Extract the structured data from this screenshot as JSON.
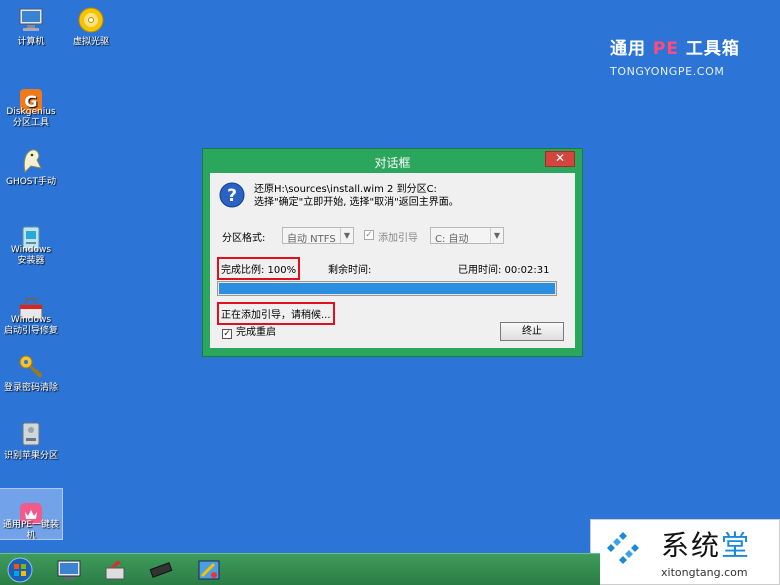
{
  "desktop": {
    "icons": [
      {
        "label": "计算机"
      },
      {
        "label": "虚拟光驱"
      },
      {
        "label": "Diskgenius\n分区工具"
      },
      {
        "label": "GHOST手动"
      },
      {
        "label": "Windows\n安装器"
      },
      {
        "label": "Windows\n启动引导修复"
      },
      {
        "label": "登录密码清除"
      },
      {
        "label": "识别苹果分区"
      },
      {
        "label": "通用PE一键装\n机"
      }
    ]
  },
  "brand": {
    "name_a": "通用 ",
    "name_pe": "PE",
    "name_b": " 工具箱",
    "domain": "TONGYONGPE.COM"
  },
  "dialog": {
    "title": "对话框",
    "close": "✕",
    "message_line1": "还原H:\\sources\\install.wim 2 到分区C:",
    "message_line2": "选择\"确定\"立即开始, 选择\"取消\"返回主界面。",
    "partition_format_label": "分区格式:",
    "partition_format_value": "自动 NTFS",
    "add_boot_label": "添加引导",
    "boot_target_value": "C: 自动",
    "complete_ratio": "完成比例: 100%",
    "remaining_time": "剩余时间:",
    "elapsed_time": "已用时间: 00:02:31",
    "progress": 1.0,
    "status": "正在添加引导，请稍候...",
    "restart_label": "完成重启",
    "stop_button": "终止"
  },
  "watermark": {
    "text_a": "系统",
    "text_b": "堂",
    "domain": "xitongtang.com"
  },
  "colors": {
    "desktop": "#2c74d6",
    "dialog_frame": "#2ba65d",
    "highlight": "#e0101e",
    "progress": "#2b8ee0"
  }
}
